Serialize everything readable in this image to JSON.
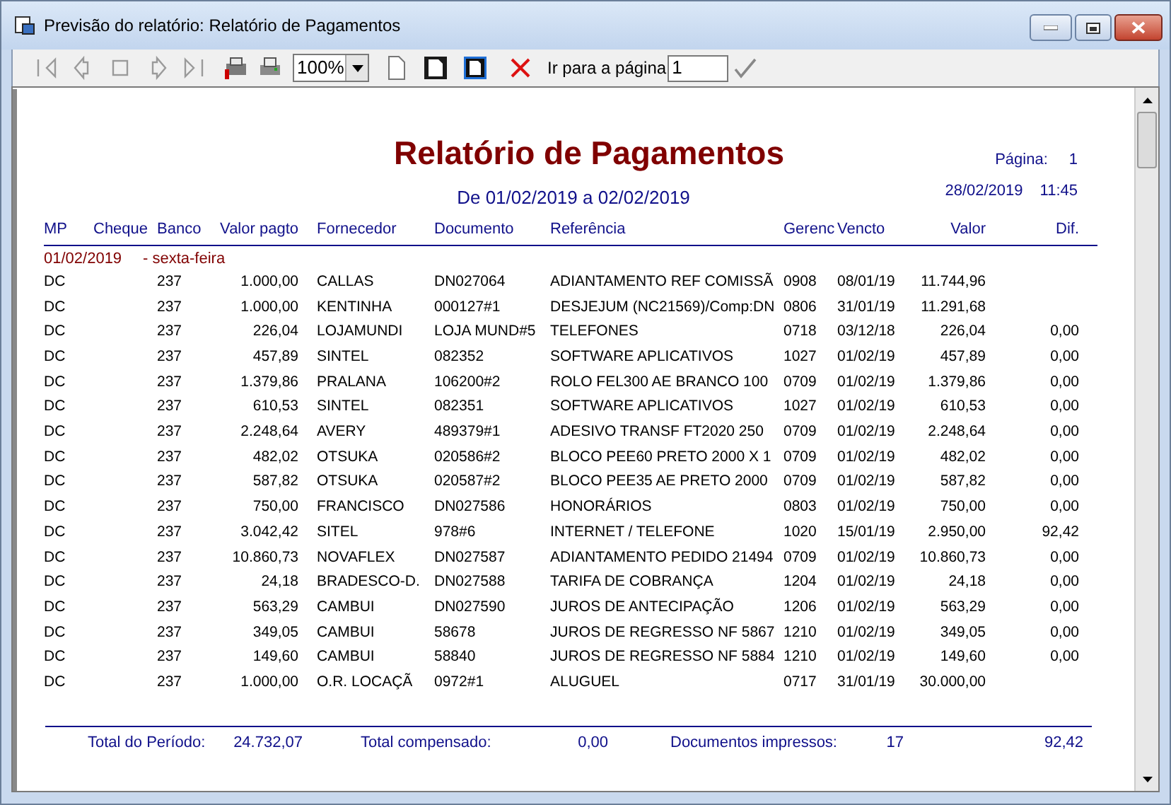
{
  "window": {
    "title": "Previsão do relatório: Relatório de Pagamentos"
  },
  "toolbar": {
    "nav_disabled": true,
    "zoom": "100%",
    "goto_label": "Ir para a página",
    "goto_page": "1"
  },
  "report": {
    "title": "Relatório de Pagamentos",
    "subtitle": "De 01/02/2019 a 02/02/2019",
    "page_label": "Página:",
    "page_number": "1",
    "date": "28/02/2019",
    "time": "11:45",
    "columns": [
      "MP",
      "Cheque",
      "Banco",
      "Valor pagto",
      "Fornecedor",
      "Documento",
      "Referência",
      "Gerenc",
      "Vencto",
      "Valor",
      "Dif."
    ],
    "groups": [
      {
        "date": "01/02/2019",
        "weekday": "- sexta-feira",
        "rows": [
          {
            "mp": "DC",
            "banco": "237",
            "valor_pagto": "1.000,00",
            "fornecedor": "CALLAS",
            "documento": "DN027064",
            "referencia": "ADIANTAMENTO REF COMISSÃ",
            "gerenc": "0908",
            "vencto": "08/01/19",
            "valor": "11.744,96"
          },
          {
            "mp": "DC",
            "banco": "237",
            "valor_pagto": "1.000,00",
            "fornecedor": "KENTINHA",
            "documento": "000127#1",
            "referencia": "DESJEJUM (NC21569)/Comp:DN",
            "gerenc": "0806",
            "vencto": "31/01/19",
            "valor": "11.291,68"
          },
          {
            "mp": "DC",
            "banco": "237",
            "valor_pagto": "226,04",
            "fornecedor": "LOJAMUNDI",
            "documento": "LOJA MUND#5",
            "referencia": "TELEFONES",
            "gerenc": "0718",
            "vencto": "03/12/18",
            "valor": "226,04",
            "dif": "0,00"
          },
          {
            "mp": "DC",
            "banco": "237",
            "valor_pagto": "457,89",
            "fornecedor": "SINTEL",
            "documento": "082352",
            "referencia": "SOFTWARE APLICATIVOS",
            "gerenc": "1027",
            "vencto": "01/02/19",
            "valor": "457,89",
            "dif": "0,00"
          },
          {
            "mp": "DC",
            "banco": "237",
            "valor_pagto": "1.379,86",
            "fornecedor": "PRALANA",
            "documento": "106200#2",
            "referencia": "ROLO FEL300 AE BRANCO 100",
            "gerenc": "0709",
            "vencto": "01/02/19",
            "valor": "1.379,86",
            "dif": "0,00"
          },
          {
            "mp": "DC",
            "banco": "237",
            "valor_pagto": "610,53",
            "fornecedor": "SINTEL",
            "documento": "082351",
            "referencia": "SOFTWARE APLICATIVOS",
            "gerenc": "1027",
            "vencto": "01/02/19",
            "valor": "610,53",
            "dif": "0,00"
          },
          {
            "mp": "DC",
            "banco": "237",
            "valor_pagto": "2.248,64",
            "fornecedor": "AVERY",
            "documento": "489379#1",
            "referencia": "ADESIVO TRANSF FT2020 250",
            "gerenc": "0709",
            "vencto": "01/02/19",
            "valor": "2.248,64",
            "dif": "0,00"
          },
          {
            "mp": "DC",
            "banco": "237",
            "valor_pagto": "482,02",
            "fornecedor": "OTSUKA",
            "documento": "020586#2",
            "referencia": "BLOCO PEE60 PRETO 2000 X 1",
            "gerenc": "0709",
            "vencto": "01/02/19",
            "valor": "482,02",
            "dif": "0,00"
          },
          {
            "mp": "DC",
            "banco": "237",
            "valor_pagto": "587,82",
            "fornecedor": "OTSUKA",
            "documento": "020587#2",
            "referencia": "BLOCO PEE35 AE PRETO 2000",
            "gerenc": "0709",
            "vencto": "01/02/19",
            "valor": "587,82",
            "dif": "0,00"
          },
          {
            "mp": "DC",
            "banco": "237",
            "valor_pagto": "750,00",
            "fornecedor": "FRANCISCO",
            "documento": "DN027586",
            "referencia": "HONORÁRIOS",
            "gerenc": "0803",
            "vencto": "01/02/19",
            "valor": "750,00",
            "dif": "0,00"
          },
          {
            "mp": "DC",
            "banco": "237",
            "valor_pagto": "3.042,42",
            "fornecedor": "SITEL",
            "documento": "978#6",
            "referencia": "INTERNET / TELEFONE",
            "gerenc": "1020",
            "vencto": "15/01/19",
            "valor": "2.950,00",
            "dif": "92,42"
          },
          {
            "mp": "DC",
            "banco": "237",
            "valor_pagto": "10.860,73",
            "fornecedor": "NOVAFLEX",
            "documento": "DN027587",
            "referencia": "ADIANTAMENTO PEDIDO 21494",
            "gerenc": "0709",
            "vencto": "01/02/19",
            "valor": "10.860,73",
            "dif": "0,00"
          },
          {
            "mp": "DC",
            "banco": "237",
            "valor_pagto": "24,18",
            "fornecedor": "BRADESCO-D.",
            "documento": "DN027588",
            "referencia": "TARIFA DE COBRANÇA",
            "gerenc": "1204",
            "vencto": "01/02/19",
            "valor": "24,18",
            "dif": "0,00"
          },
          {
            "mp": "DC",
            "banco": "237",
            "valor_pagto": "563,29",
            "fornecedor": "CAMBUI",
            "documento": "DN027590",
            "referencia": "JUROS DE ANTECIPAÇÃO",
            "gerenc": "1206",
            "vencto": "01/02/19",
            "valor": "563,29",
            "dif": "0,00"
          },
          {
            "mp": "DC",
            "banco": "237",
            "valor_pagto": "349,05",
            "fornecedor": "CAMBUI",
            "documento": "58678",
            "referencia": "JUROS DE REGRESSO NF 5867",
            "gerenc": "1210",
            "vencto": "01/02/19",
            "valor": "349,05",
            "dif": "0,00"
          },
          {
            "mp": "DC",
            "banco": "237",
            "valor_pagto": "149,60",
            "fornecedor": "CAMBUI",
            "documento": "58840",
            "referencia": "JUROS DE REGRESSO NF 5884",
            "gerenc": "1210",
            "vencto": "01/02/19",
            "valor": "149,60",
            "dif": "0,00"
          },
          {
            "mp": "DC",
            "banco": "237",
            "valor_pagto": "1.000,00",
            "fornecedor": "O.R. LOCAÇÃ",
            "documento": "0972#1",
            "referencia": "ALUGUEL",
            "gerenc": "0717",
            "vencto": "31/01/19",
            "valor": "30.000,00"
          }
        ]
      }
    ],
    "totals": {
      "period_label": "Total do Período:",
      "period_value": "24.732,07",
      "compensated_label": "Total compensado:",
      "compensated_value": "0,00",
      "printed_label": "Documentos impressos:",
      "printed_value": "17",
      "dif_total": "92,42"
    }
  }
}
